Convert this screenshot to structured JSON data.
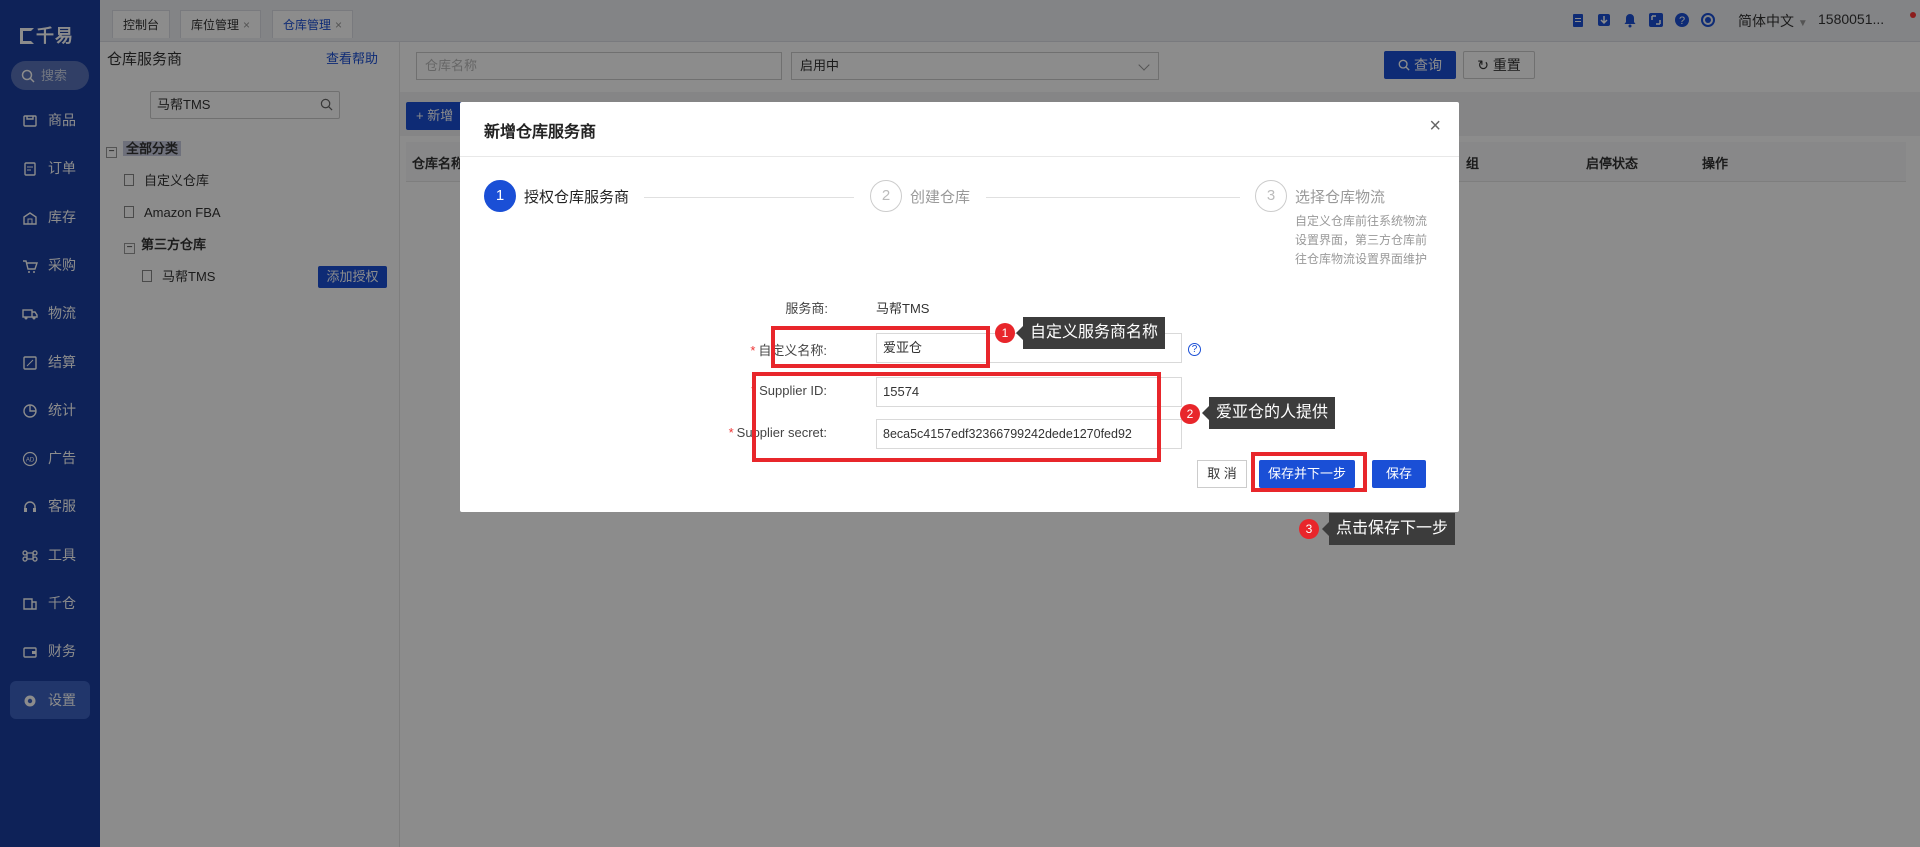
{
  "app": {
    "logo": "千易",
    "search_label": "搜索"
  },
  "nav": [
    {
      "label": "商品",
      "icon": "product-icon"
    },
    {
      "label": "订单",
      "icon": "order-icon"
    },
    {
      "label": "库存",
      "icon": "inventory-icon"
    },
    {
      "label": "采购",
      "icon": "cart-icon"
    },
    {
      "label": "物流",
      "icon": "truck-icon"
    },
    {
      "label": "结算",
      "icon": "settle-icon"
    },
    {
      "label": "统计",
      "icon": "pie-icon"
    },
    {
      "label": "广告",
      "icon": "ad-icon"
    },
    {
      "label": "客服",
      "icon": "headset-icon"
    },
    {
      "label": "工具",
      "icon": "command-icon"
    },
    {
      "label": "千仓",
      "icon": "warehouse-icon"
    },
    {
      "label": "财务",
      "icon": "wallet-icon"
    },
    {
      "label": "设置",
      "icon": "gear-icon",
      "active": true
    }
  ],
  "tabs": [
    {
      "label": "控制台",
      "closable": false
    },
    {
      "label": "库位管理",
      "closable": true
    },
    {
      "label": "仓库管理",
      "closable": true,
      "active": true
    }
  ],
  "topbar": {
    "lang": "简体中文",
    "user": "1580051..."
  },
  "left_panel": {
    "title": "仓库服务商",
    "help": "查看帮助",
    "search_value": "马帮TMS",
    "tree": {
      "root": "全部分类",
      "items": [
        "自定义仓库",
        "Amazon FBA"
      ],
      "group": "第三方仓库",
      "child": "马帮TMS",
      "auth_button": "添加授权"
    }
  },
  "main": {
    "name_placeholder": "仓库名称",
    "status_select": "启用中",
    "query_button": "查询",
    "reset_button": "重置",
    "new_button": "新增",
    "columns": [
      "仓库名称",
      "组",
      "启停状态",
      "操作"
    ]
  },
  "modal": {
    "title": "新增仓库服务商",
    "steps": [
      {
        "num": "1",
        "label": "授权仓库服务商"
      },
      {
        "num": "2",
        "label": "创建仓库"
      },
      {
        "num": "3",
        "label": "选择仓库物流"
      }
    ],
    "step3_desc": "自定义仓库前往系统物流设置界面，第三方仓库前往仓库物流设置界面维护",
    "provider_label": "服务商:",
    "provider_value": "马帮TMS",
    "custom_name_label": "自定义名称:",
    "custom_name_value": "爱亚仓",
    "supplier_id_label": "Supplier ID:",
    "supplier_id_value": "15574",
    "supplier_secret_label": "Supplier secret:",
    "supplier_secret_value": "8eca5c4157edf32366799242dede1270fed92",
    "cancel": "取 消",
    "save_next": "保存并下一步",
    "save": "保存"
  },
  "annotations": [
    {
      "num": "1",
      "text": "自定义服务商名称"
    },
    {
      "num": "2",
      "text": "爱亚仓的人提供"
    },
    {
      "num": "3",
      "text": "点击保存下一步"
    }
  ],
  "colors": {
    "sidebar": "#1a3fa0",
    "primary": "#1a4fd6",
    "annotation_red": "#e8262b"
  }
}
